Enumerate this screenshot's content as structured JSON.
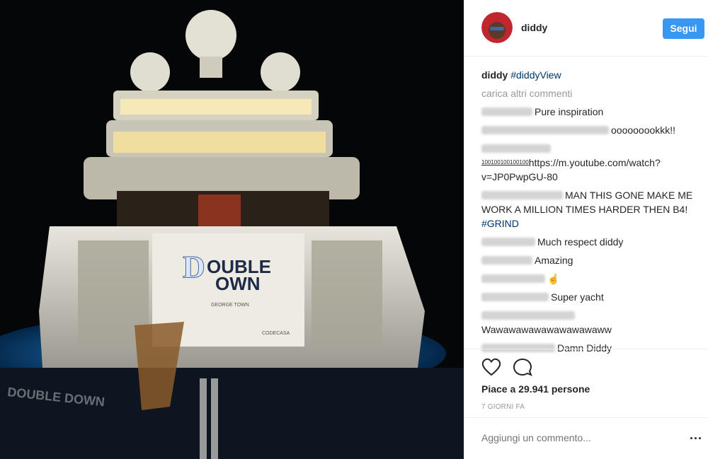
{
  "post": {
    "username": "diddy",
    "follow_label": "Segui",
    "caption_hashtag": "#diddyView",
    "load_more": "carica altri commenti",
    "likes_text": "Piace a 29.941 persone",
    "time_text": "7 GIORNI FA",
    "add_comment_placeholder": "Aggiungi un commento...",
    "more_label": "..."
  },
  "photo": {
    "yacht_name_line1": "OUBLE",
    "yacht_name_line2": "OWN",
    "yacht_port": "GEORGE TOWN",
    "builder": "CODECASA",
    "deck_text": "DOUBLE DOWN",
    "sky_color": "#050608",
    "water_color": "#0b6fc0"
  },
  "comments": [
    {
      "text": "Pure inspiration"
    },
    {
      "text": "ooooooookkk!!"
    },
    {
      "text": "https://m.youtube.com/watch?v=JP0PwpGU-80",
      "prefix": "100100100100100"
    },
    {
      "text": "MAN THIS GONE MAKE ME WORK A MILLION TIMES HARDER THEN B4!",
      "hashtag": "#GRIND"
    },
    {
      "text": "Much respect diddy"
    },
    {
      "text": "Amazing"
    },
    {
      "text": "☝"
    },
    {
      "text": "Super yacht"
    },
    {
      "text": "Wawawawawawawawawaww"
    },
    {
      "text": "Damn Diddy"
    }
  ]
}
